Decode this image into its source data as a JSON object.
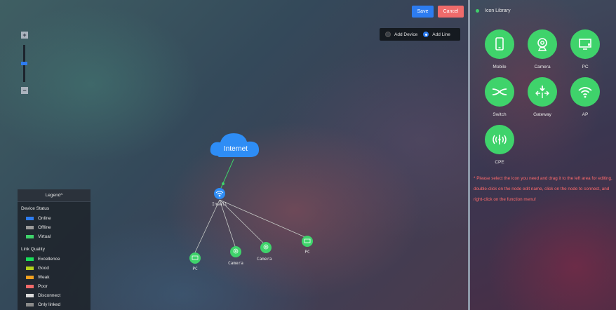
{
  "toolbar": {
    "save_label": "Save",
    "cancel_label": "Cancel"
  },
  "mode": {
    "add_device": "Add Device",
    "add_line": "Add Line",
    "selected": "Add Line"
  },
  "zoom": {
    "plus": "+",
    "minus": "−",
    "level": 0.45
  },
  "legend": {
    "title": "Legend^",
    "device_status_title": "Device Status",
    "device_status": [
      {
        "label": "Online",
        "color": "#2d7cf0"
      },
      {
        "label": "Offline",
        "color": "#9a9a9a"
      },
      {
        "label": "Virtual",
        "color": "#3fd36b"
      }
    ],
    "link_quality_title": "Link Quality",
    "link_quality": [
      {
        "label": "Excellence",
        "color": "#19e05a"
      },
      {
        "label": "Good",
        "color": "#b4d21c"
      },
      {
        "label": "Weak",
        "color": "#f0a020"
      },
      {
        "label": "Poor",
        "color": "#f06a6a"
      },
      {
        "label": "Disconnect",
        "color": "#d9d9d9"
      },
      {
        "label": "Only linked",
        "color": "#8a8a8a"
      }
    ]
  },
  "topology": {
    "cloud_label": "Internet",
    "nodes": [
      {
        "label": "Inwall",
        "icon": "ap-icon",
        "status": "online"
      },
      {
        "label": "PC",
        "icon": "pc-icon"
      },
      {
        "label": "Camera",
        "icon": "camera-icon"
      },
      {
        "label": "Camera",
        "icon": "camera-icon"
      },
      {
        "label": "PC",
        "icon": "pc-icon"
      }
    ]
  },
  "library": {
    "title": "Icon Library",
    "items": [
      {
        "label": "Mobile",
        "icon": "mobile-icon"
      },
      {
        "label": "Camera",
        "icon": "camera-icon"
      },
      {
        "label": "PC",
        "icon": "pc-icon"
      },
      {
        "label": "Switch",
        "icon": "switch-icon"
      },
      {
        "label": "Gateway",
        "icon": "gateway-icon"
      },
      {
        "label": "AP",
        "icon": "ap-icon"
      },
      {
        "label": "CPE",
        "icon": "cpe-icon"
      }
    ],
    "hint": "* Please select the icon you need and drag it to the left area for editing, double-click on the node edit name, click on the node to connect, and right-click on the function menu!"
  },
  "colors": {
    "accent": "#2d7cf0",
    "device_green": "#3fd36b",
    "danger": "#ef6b6b"
  }
}
